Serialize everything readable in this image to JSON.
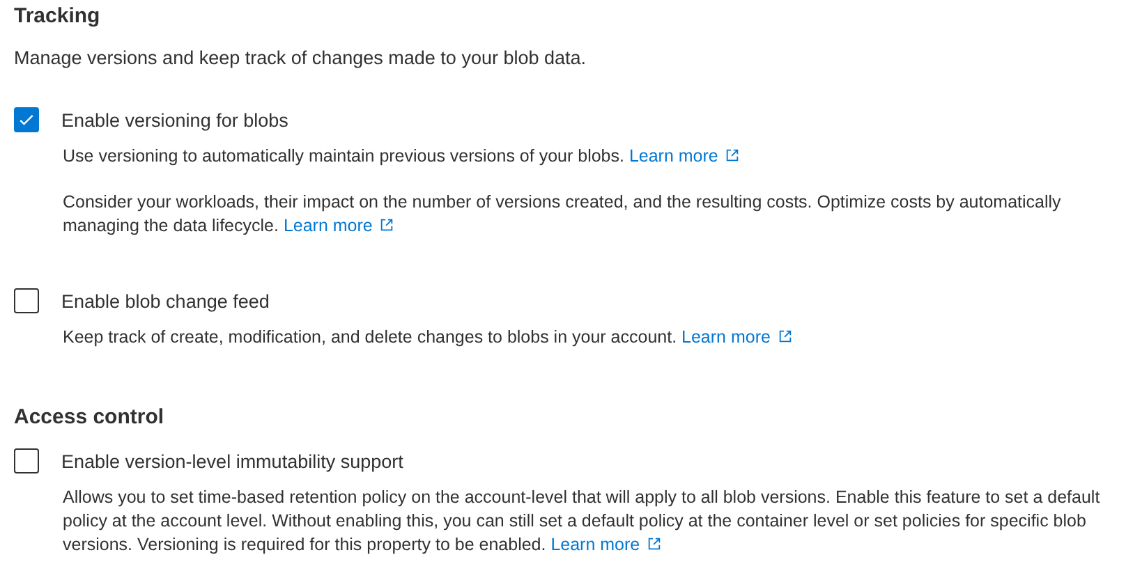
{
  "sections": [
    {
      "title": "Tracking",
      "description": "Manage versions and keep track of changes made to your blob data.",
      "options": [
        {
          "label": "Enable versioning for blobs",
          "checked": true,
          "paragraphs": [
            {
              "text": "Use versioning to automatically maintain previous versions of your blobs.",
              "link": "Learn more"
            },
            {
              "text": "Consider your workloads, their impact on the number of versions created, and the resulting costs. Optimize costs by automatically managing the data lifecycle.",
              "link": "Learn more"
            }
          ]
        },
        {
          "label": "Enable blob change feed",
          "checked": false,
          "paragraphs": [
            {
              "text": "Keep track of create, modification, and delete changes to blobs in your account.",
              "link": "Learn more"
            }
          ]
        }
      ]
    },
    {
      "title": "Access control",
      "options": [
        {
          "label": "Enable version-level immutability support",
          "checked": false,
          "paragraphs": [
            {
              "text": "Allows you to set time-based retention policy on the account-level that will apply to all blob versions. Enable this feature to set a default policy at the account level. Without enabling this, you can still set a default policy at the container level or set policies for specific blob versions. Versioning is required for this property to be enabled.",
              "link": "Learn more"
            }
          ]
        }
      ]
    }
  ]
}
